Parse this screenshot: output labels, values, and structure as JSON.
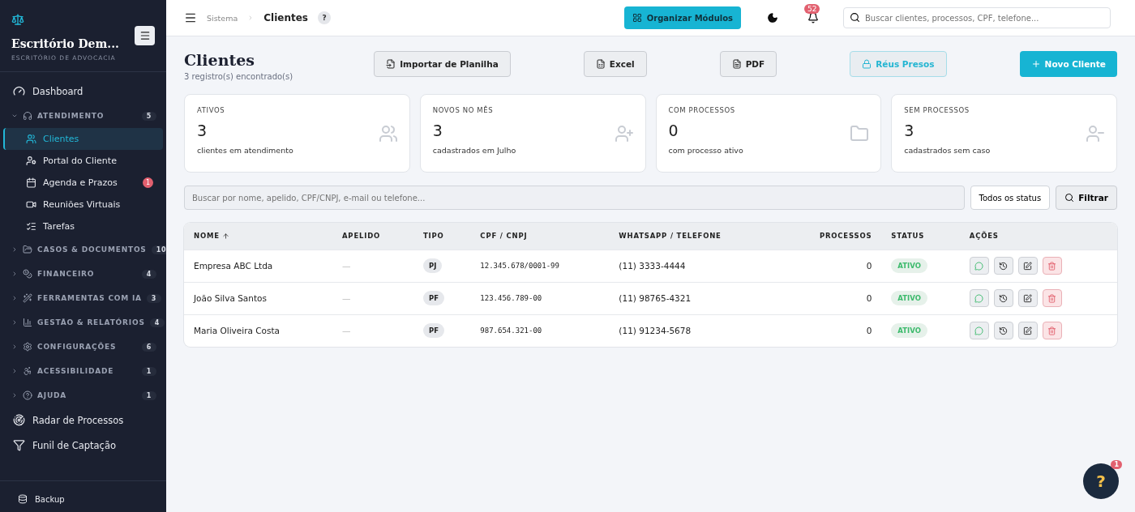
{
  "sidebar": {
    "brand_title": "Escritório Dem...",
    "brand_subtitle": "ESCRITÓRIO DE ADVOCACIA",
    "nav": [
      {
        "kind": "link",
        "label": "Dashboard"
      },
      {
        "kind": "group",
        "label": "ATENDIMENTO",
        "count": "5",
        "expanded": true,
        "children": [
          {
            "label": "Clientes",
            "selected": true
          },
          {
            "label": "Portal do Cliente",
            "selected": false
          },
          {
            "label": "Agenda e Prazos",
            "selected": false,
            "badge": "1"
          },
          {
            "label": "Reuniões Virtuais",
            "selected": false
          },
          {
            "label": "Tarefas",
            "selected": false
          }
        ]
      },
      {
        "kind": "group",
        "label": "CASOS & DOCUMENTOS",
        "count": "10",
        "expanded": false
      },
      {
        "kind": "group",
        "label": "FINANCEIRO",
        "count": "4",
        "expanded": false
      },
      {
        "kind": "group",
        "label": "FERRAMENTAS COM IA",
        "count": "3",
        "expanded": false
      },
      {
        "kind": "group",
        "label": "GESTÃO & RELATÓRIOS",
        "count": "4",
        "expanded": false
      },
      {
        "kind": "group",
        "label": "CONFIGURAÇÕES",
        "count": "6",
        "expanded": false
      },
      {
        "kind": "group",
        "label": "ACESSIBILIDADE",
        "count": "1",
        "expanded": false
      },
      {
        "kind": "group",
        "label": "AJUDA",
        "count": "1",
        "expanded": false
      },
      {
        "kind": "link",
        "label": "Radar de Processos"
      },
      {
        "kind": "link",
        "label": "Funil de Captação"
      }
    ],
    "footer_item": "Backup"
  },
  "header": {
    "breadcrumb": [
      "Sistema",
      "Clientes"
    ],
    "help": "?",
    "organize_button": "Organizar Módulos",
    "notifications": "52",
    "search": {
      "placeholder": "Buscar clientes, processos, CPF, telefone..."
    }
  },
  "page": {
    "title": "Clientes",
    "subtitle": "3 registro(s) encontrado(s)",
    "actions": [
      {
        "label": "Importar de Planilha",
        "kind": "default"
      },
      {
        "label": "Excel",
        "kind": "default"
      },
      {
        "label": "PDF",
        "kind": "default"
      },
      {
        "label": "Réus Presos",
        "kind": "accent"
      },
      {
        "label": "Novo Cliente",
        "kind": "primary"
      }
    ]
  },
  "stats": [
    {
      "label": "ATIVOS",
      "value": "3",
      "caption": "clientes em atendimento"
    },
    {
      "label": "NOVOS NO MÊS",
      "value": "3",
      "caption": "cadastrados em Julho"
    },
    {
      "label": "COM PROCESSOS",
      "value": "0",
      "caption": "com processo ativo"
    },
    {
      "label": "SEM PROCESSOS",
      "value": "3",
      "caption": "cadastrados sem caso"
    }
  ],
  "filters": {
    "search": {
      "placeholder": "Buscar por nome, apelido, CPF/CNPJ, e-mail ou telefone..."
    },
    "status": "Todos os status",
    "button": "Filtrar"
  },
  "table": {
    "columns": [
      {
        "label": "NOME",
        "sorted": true
      },
      {
        "label": "APELIDO",
        "sorted": false
      },
      {
        "label": "TIPO",
        "sorted": false
      },
      {
        "label": "CPF / CNPJ",
        "sorted": false
      },
      {
        "label": "WHATSAPP / TELEFONE",
        "sorted": false
      },
      {
        "label": "PROCESSOS",
        "sorted": false
      },
      {
        "label": "STATUS",
        "sorted": false
      },
      {
        "label": "AÇÕES",
        "sorted": false
      }
    ],
    "rows": [
      {
        "name": "Empresa ABC Ltda",
        "nickname": "—",
        "type": "PJ",
        "document": "12.345.678/0001-99",
        "phone": "(11) 3333-4444",
        "processes": "0",
        "status": "ATIVO"
      },
      {
        "name": "João Silva Santos",
        "nickname": "—",
        "type": "PF",
        "document": "123.456.789-00",
        "phone": "(11) 98765-4321",
        "processes": "0",
        "status": "ATIVO"
      },
      {
        "name": "Maria Oliveira Costa",
        "nickname": "—",
        "type": "PF",
        "document": "987.654.321-00",
        "phone": "(11) 91234-5678",
        "processes": "0",
        "status": "ATIVO"
      }
    ]
  },
  "help_fab": {
    "label": "?",
    "badge": "1"
  }
}
